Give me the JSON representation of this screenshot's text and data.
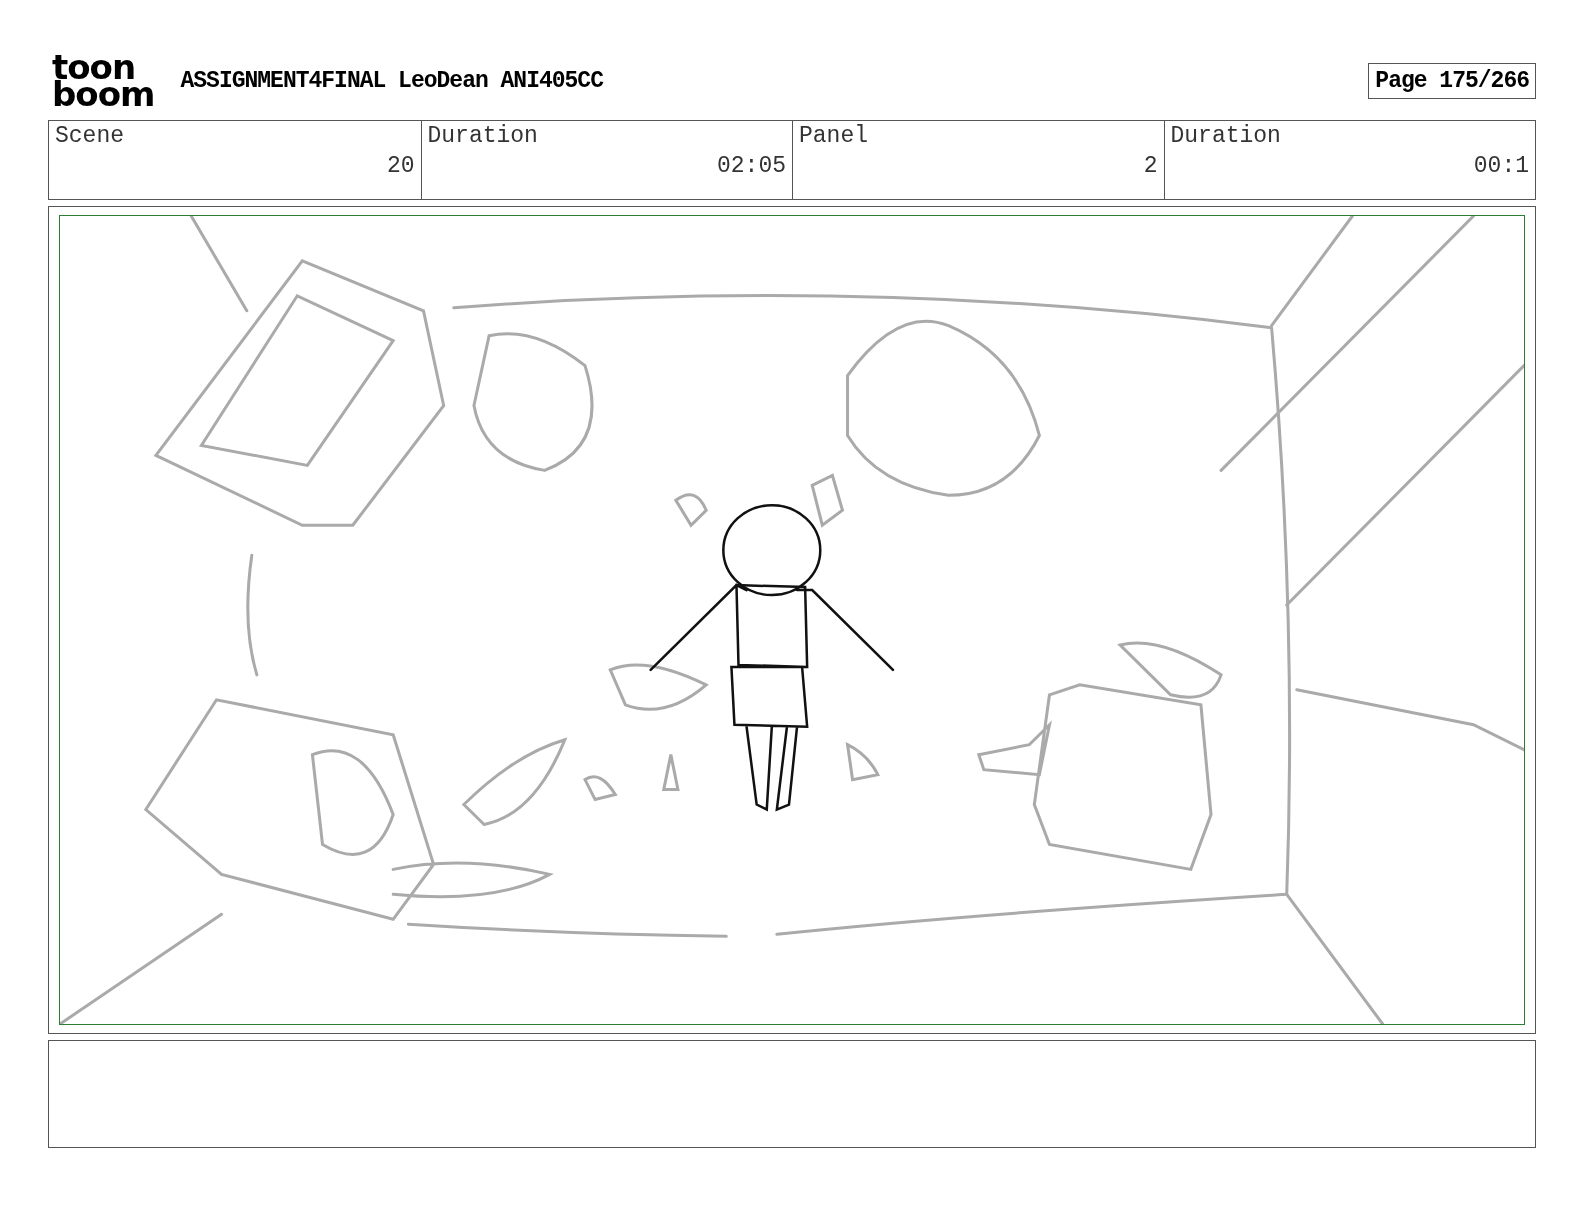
{
  "logo": [
    "toon",
    "boom"
  ],
  "title": "ASSIGNMENT4FINAL LeoDean ANI405CC",
  "page": "Page 175/266",
  "info_table": {
    "columns": [
      "Scene",
      "Duration",
      "Panel",
      "Duration"
    ],
    "values": [
      "20",
      "02:05",
      "2",
      "00:1"
    ]
  }
}
